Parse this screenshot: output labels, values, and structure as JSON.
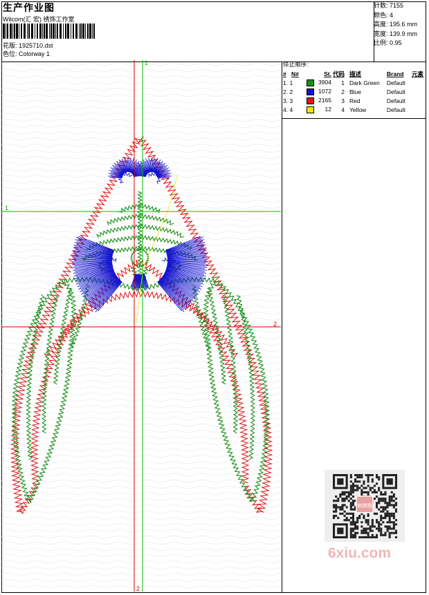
{
  "header": {
    "title": "生产作业图",
    "subtitle": "Wilcom(汇 宏) 绣饰工作室",
    "design_label": "花版: 1925710.dst",
    "colorway_label": "色位: Colorway 1"
  },
  "stats": [
    {
      "label": "针数: 7155"
    },
    {
      "label": "颜色: 4"
    },
    {
      "label": "高度: 195.6 mm"
    },
    {
      "label": "宽度: 139.9 mm"
    },
    {
      "label": "比例: 0.95"
    }
  ],
  "stop_sequence": {
    "title": "停止顺序:",
    "columns": [
      "#",
      "N#",
      "St.",
      "代码",
      "描述",
      "Brand",
      "元素"
    ],
    "rows": [
      {
        "num": "1. 1",
        "color": "#1a8f1a",
        "stitches": "3904",
        "code": "1",
        "desc": "Dark Green",
        "brand": "Default"
      },
      {
        "num": "2. 2",
        "color": "#1414d0",
        "stitches": "1072",
        "code": "2",
        "desc": "Blue",
        "brand": "Default"
      },
      {
        "num": "3. 3",
        "color": "#e01414",
        "stitches": "2165",
        "code": "3",
        "desc": "Red",
        "brand": "Default"
      },
      {
        "num": "4. 4",
        "color": "#f0e600",
        "stitches": "12",
        "code": "4",
        "desc": "Yellow",
        "brand": "Default"
      }
    ]
  },
  "crosshair": {
    "label_top": "1",
    "label_left": "1",
    "label_right": "2",
    "label_bottom": "2"
  },
  "watermark": {
    "text": "6xiu.com",
    "qr_tag": "刺绣图"
  },
  "colors": {
    "green": "#1a8f1a",
    "blue": "#1414d0",
    "red": "#e01414",
    "yellow": "#f0e600",
    "guide_red": "#d00000",
    "guide_green": "#00c000"
  }
}
